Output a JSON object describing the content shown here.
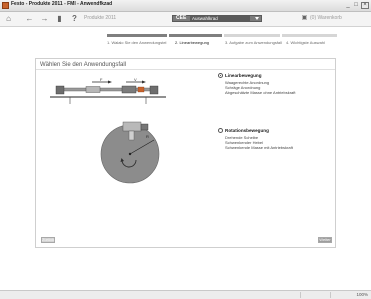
{
  "window": {
    "title": "Festo - Produkte 2011 - FMI - Anwendfkzad"
  },
  "toolbar": {
    "products_label": "Produkte 2011",
    "product_code": "CEE",
    "selected_view": "Auswahlkrad",
    "basket_label": "(0) Warenkorb"
  },
  "steps": [
    {
      "label": "1. Walalo Sie den Anwendungstel",
      "active": false
    },
    {
      "label": "2. Linearbewegung",
      "active": true
    },
    {
      "label": "3. Aufgabe zum Anwendungsfall",
      "active": false
    },
    {
      "label": "4. Wichtigste Auswahl",
      "active": false
    }
  ],
  "panel": {
    "title": "Wählen Sie den Anwendungsfall"
  },
  "options": [
    {
      "title": "Linearbewegung",
      "checked": true,
      "items": [
        "Waagerechte Anordnung",
        "Schräge Anordnung",
        "Abgeschätzte Masse ohne Antriebskraft"
      ]
    },
    {
      "title": "Rotationsbewegung",
      "checked": false,
      "items": [
        "Drehende Scheibe",
        "Schwenkender Hebel",
        "Schwenkende Masse mit Antriebskraft"
      ]
    }
  ],
  "illustration": {
    "arrow_label_1": "F",
    "arrow_label_2": "V",
    "disc_label": "R"
  },
  "buttons": {
    "back": "Zurück",
    "next": "Weiter"
  },
  "status": {
    "zoom": "100%"
  },
  "colors": {
    "accent": "#c8632c",
    "step_active": "#7f7f7f",
    "step_inactive": "#d6d6d6",
    "disc": "#8c8c8c"
  }
}
